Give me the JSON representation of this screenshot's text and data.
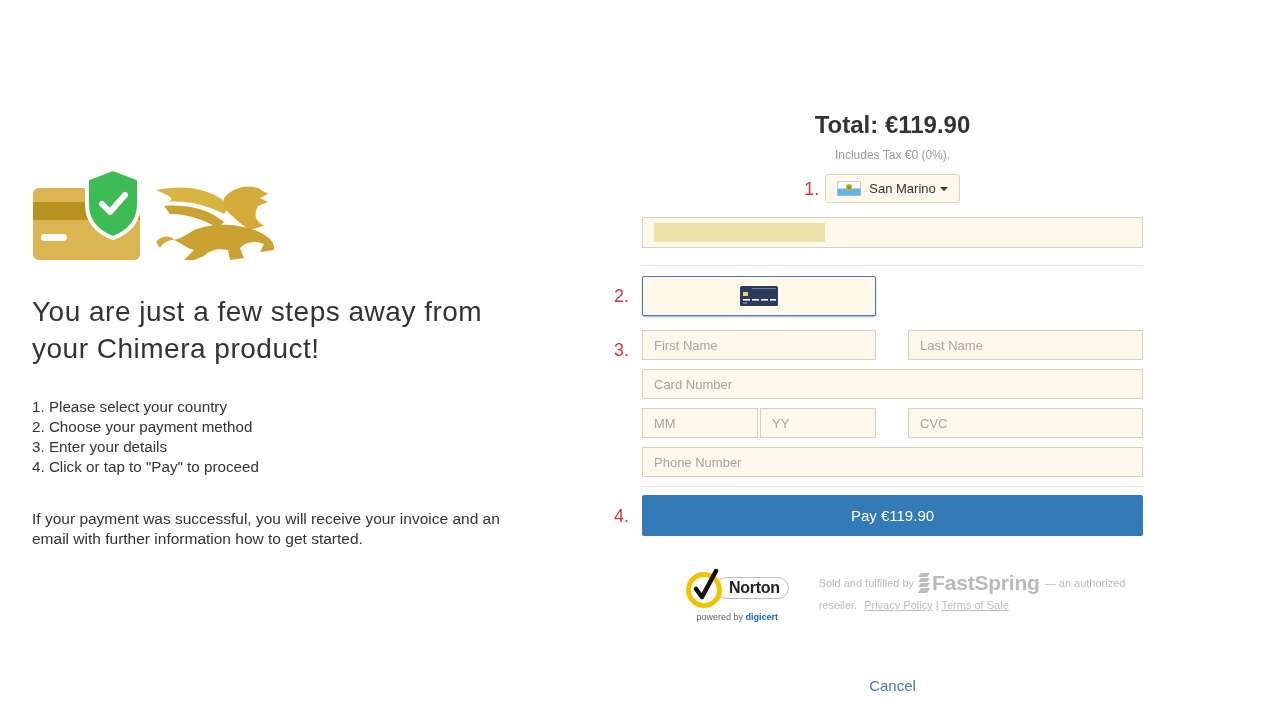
{
  "intro": {
    "heading": "You are just a few steps away from your Chimera product!",
    "steps": [
      "1. Please select your country",
      "2. Choose your payment method",
      "3. Enter your details",
      "4. Click or tap to \"Pay\" to proceed"
    ],
    "note": "If your payment was successful, you will receive your invoice and an email with further information how to get started."
  },
  "checkout": {
    "total": "Total: €119.90",
    "tax_note": "Includes Tax €0 (0%).",
    "country": {
      "step": "1.",
      "value": "San Marino"
    },
    "account_field": {
      "redacted": true
    },
    "payment": {
      "step": "2.",
      "methods": [
        {
          "kind": "card",
          "selected": true
        }
      ]
    },
    "details": {
      "step": "3.",
      "name_fields": [
        {
          "placeholder": "First Name"
        },
        {
          "placeholder": "Last Name"
        }
      ],
      "card_number": {
        "placeholder": "Card Number"
      },
      "expiry_fields": [
        {
          "placeholder": "MM"
        },
        {
          "placeholder": "YY"
        }
      ],
      "cvc": {
        "placeholder": "CVC"
      },
      "phone": {
        "placeholder": "Phone Number"
      }
    },
    "pay": {
      "step": "4.",
      "label": "Pay €119.90"
    },
    "trust_seal": {
      "wordmark": "Norton",
      "caption": "powered by **digicert**"
    },
    "reseller": {
      "lead": "Sold and fulfilled by",
      "brand": "FastSpring",
      "tail": "— an authorized",
      "tail_end": "reseller.",
      "links": [
        "Privacy Policy",
        "Terms of Sale"
      ],
      "separator": "|"
    },
    "cancel": "Cancel"
  }
}
